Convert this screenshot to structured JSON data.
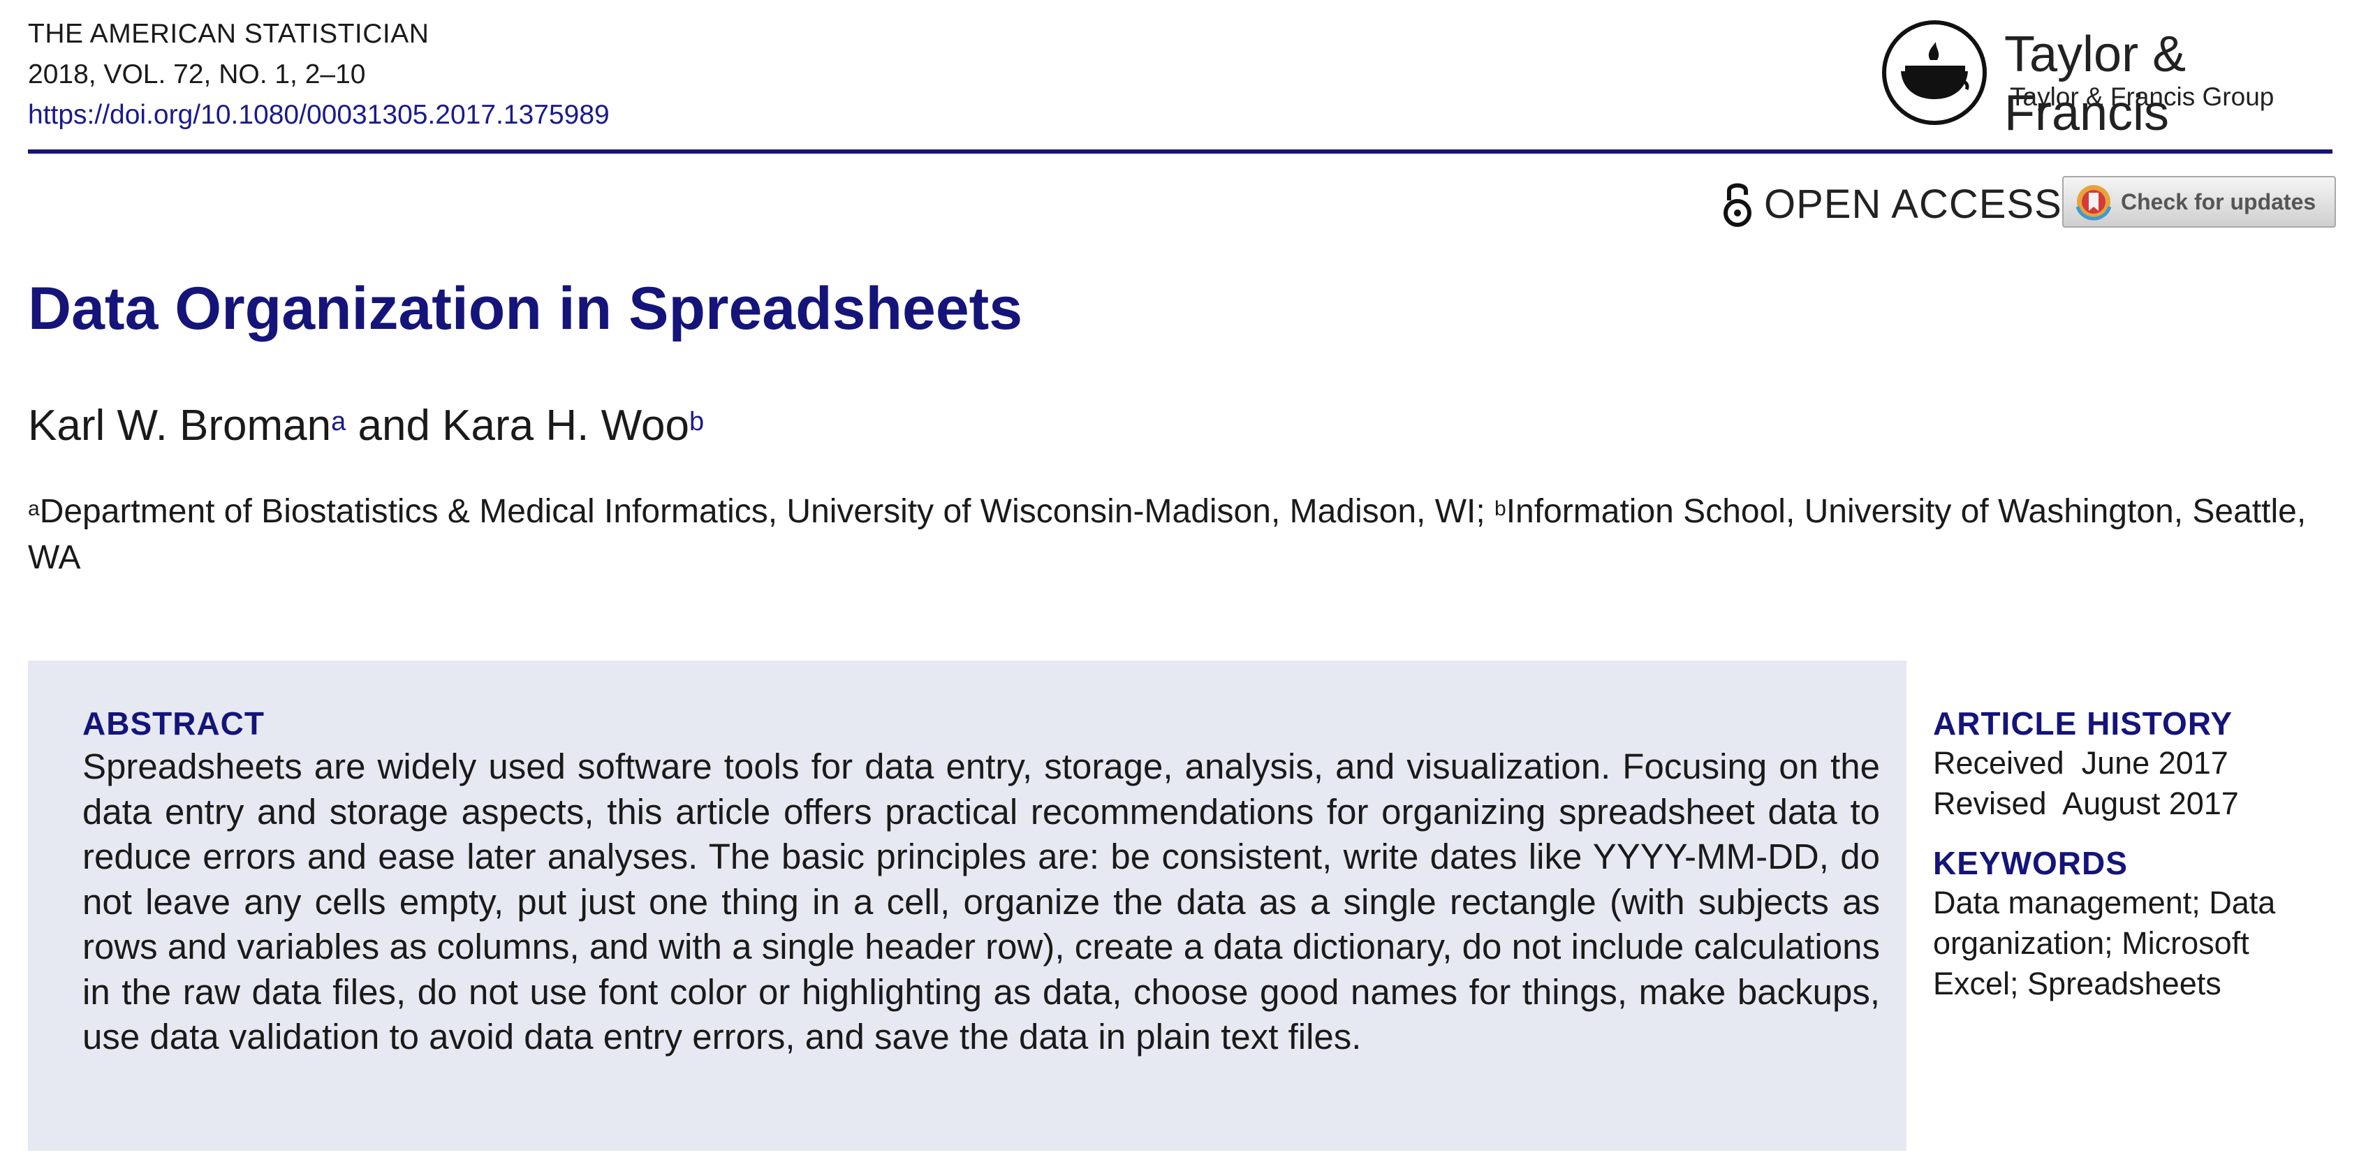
{
  "journal": {
    "name": "THE AMERICAN STATISTICIAN",
    "citation": "2018, VOL. 72, NO. 1, 2–10",
    "doi": "https://doi.org/10.1080/00031305.2017.1375989"
  },
  "publisher": {
    "name": "Taylor & Francis",
    "group": "Taylor & Francis Group"
  },
  "badges": {
    "open_access": "OPEN ACCESS",
    "check_updates": "Check for updates"
  },
  "article": {
    "title": "Data Organization in Spreadsheets",
    "authors": [
      {
        "name": "Karl W. Broman",
        "mark": "a"
      },
      {
        "name": "Kara H. Woo",
        "mark": "b"
      }
    ],
    "author_joiner": " and ",
    "affiliations": [
      {
        "mark": "a",
        "text": "Department of Biostatistics & Medical Informatics, University of Wisconsin-Madison, Madison, WI; "
      },
      {
        "mark": "b",
        "text": "Information School, University of Washington, Seattle, WA"
      }
    ]
  },
  "abstract": {
    "heading": "ABSTRACT",
    "text": "Spreadsheets are widely used software tools for data entry, storage, analysis, and visualization. Focusing on the data entry and storage aspects, this article offers practical recommendations for organizing spreadsheet data to reduce errors and ease later analyses. The basic principles are: be consistent, write dates like YYYY-MM-DD, do not leave any cells empty, put just one thing in a cell, organize the data as a single rectangle (with subjects as rows and variables as columns, and with a single header row), create a data dictionary, do not include calculations in the raw data files, do not use font color or highlighting as data, choose good names for things, make backups, use data validation to avoid data entry errors, and save the data in plain text files."
  },
  "sidebar": {
    "history_heading": "ARTICLE HISTORY",
    "received": "Received  June 2017",
    "revised": "Revised  August 2017",
    "keywords_heading": "KEYWORDS",
    "keywords": "Data management; Data organization; Microsoft Excel; Spreadsheets"
  },
  "colors": {
    "accent": "#14147a",
    "link": "#1a1a8c",
    "abstract_background": "#e6e9f2"
  },
  "icons": [
    "taylor-francis-lamp-logo",
    "open-lock-icon",
    "crossmark-icon"
  ]
}
